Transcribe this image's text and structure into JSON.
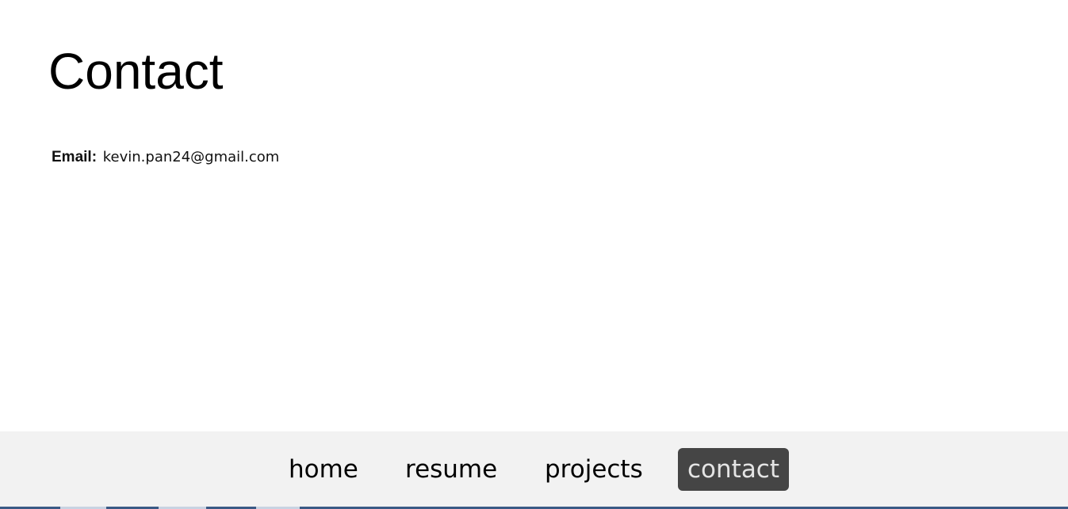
{
  "page": {
    "title": "Contact"
  },
  "contact": {
    "email_label": "Email:",
    "email_value": "kevin.pan24@gmail.com"
  },
  "nav": {
    "items": [
      {
        "label": "home",
        "active": false
      },
      {
        "label": "resume",
        "active": false
      },
      {
        "label": "projects",
        "active": false
      },
      {
        "label": "contact",
        "active": true
      }
    ]
  },
  "colors": {
    "nav_background": "#f2f2f2",
    "active_background": "#454545",
    "active_text": "#e4e4e4"
  }
}
